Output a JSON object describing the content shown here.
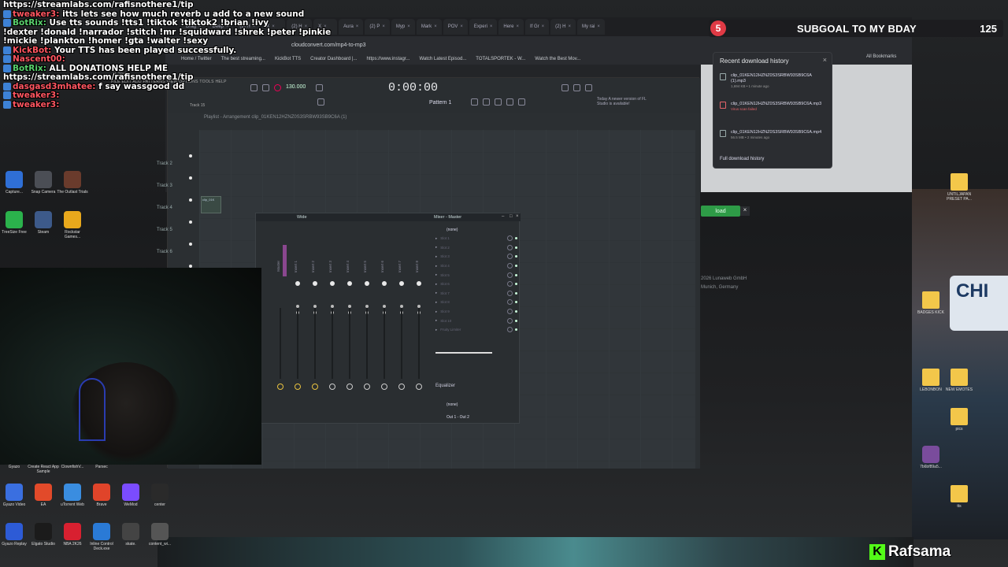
{
  "chat": {
    "lines": [
      {
        "text": "https://streamlabs.com/rafisnothere1/tip",
        "type": "plain"
      },
      {
        "user": "tweaker3:",
        "text": " itts lets see how much reverb u add to a new sound"
      },
      {
        "user": "BotRix:",
        "text": " Use tts sounds !tts1 !tiktok !tiktok2 !brian !ivy",
        "green": true
      },
      {
        "user": "",
        "text": "!dexter !donald !narrador !stitch !mr !squidward !shrek !peter !pinkie"
      },
      {
        "user": "",
        "text": "!mickie !plankton !homer !gta !walter !sexy"
      },
      {
        "user": "KickBot:",
        "text": " Your TTS has been played successfully."
      },
      {
        "user": "Nascent00:",
        "text": ""
      },
      {
        "user": "BotRix:",
        "text": " ALL DONATIONS HELP ME",
        "green": true
      },
      {
        "user": "",
        "text": "https://streamlabs.com/rafisnothere1/tip"
      },
      {
        "user": "dasgasd3mhatee:",
        "text": " f say wassgood dd"
      },
      {
        "user": "tweaker3:",
        "text": ""
      },
      {
        "user": "tweaker3:",
        "text": ""
      }
    ]
  },
  "subgoal": {
    "number": "5",
    "label": "SUBGOAL TO MY BDAY",
    "count": "125"
  },
  "browser": {
    "tabs": [
      "Drag",
      "Deep",
      "(2) H",
      "X",
      "(2) H",
      "X",
      "Aura",
      "(2) P",
      "Myp",
      "Mark",
      "POV",
      "Experi",
      "Here",
      "If Gr",
      "(2) H",
      "My rai"
    ],
    "url": "cloudconvert.com/mp4-to-mp3",
    "bookmarks": [
      "Home / Twitter",
      "The best streaming...",
      "KickBot TTS",
      "Creator Dashboard |...",
      "https://www.instagr...",
      "Watch Latest Episod...",
      "TOTALSPORTEK - W...",
      "Watch the Best Mov..."
    ],
    "all_bookmarks": "All Bookmarks",
    "page_button": "load",
    "page_footer_1": "2026 Lunaweb GmbH",
    "page_footer_2": "Munich, Germany"
  },
  "downloads": {
    "title": "Recent download history",
    "items": [
      {
        "name": "clip_01KEN12HZNZ0S3SRBW93SB9C6A (1).mp3",
        "status": "1,694 KB • 1 minute ago",
        "error": false
      },
      {
        "name": "clip_01KEN12HZNZ0S3SRBW93SB9C6A.mp3",
        "status": "Virus scan failed",
        "error": true
      },
      {
        "name": "clip_01KEN12HZNZ0S3SRBW93SB9C6A.mp4",
        "status": "56.5 MB • 2 minutes ago",
        "error": false
      }
    ],
    "full_history": "Full download history"
  },
  "fl": {
    "menu": "FILE EDIT ADD PATTERNS VIEW OPTIONS TOOLS HELP",
    "studio": "FL Studio",
    "track_label": "Track 15",
    "tempo": "130.000",
    "time": "0:00:00",
    "pattern": "Pattern 1",
    "news": "Today  A newer version of FL Studio is available!",
    "playlist_title": "Playlist - Arrangement  clip_01KEN12HZNZ0S3SRBW93SB9C6A (1)",
    "tracks": [
      "Track 1",
      "Track 2",
      "Track 3",
      "Track 4",
      "Track 5",
      "Track 6"
    ],
    "clip_label": "clip_01K"
  },
  "mixer": {
    "title": "Wide",
    "master_title": "Mixer - Master",
    "none": "(none)",
    "strips": [
      "Master",
      "Insert 1",
      "Insert 2",
      "Insert 3",
      "Insert 4",
      "Insert 5",
      "Insert 6",
      "Insert 7",
      "Insert 8"
    ],
    "slots": [
      "Slot 1",
      "Slot 2",
      "Slot 3",
      "Slot 4",
      "Slot 5",
      "Slot 6",
      "Slot 7",
      "Slot 8",
      "Slot 9",
      "Slot 10",
      "Fruity Limiter"
    ],
    "equalizer": "Equalizer",
    "none2": "(none)",
    "out": "Out 1 - Out 2"
  },
  "desktop_icons": {
    "left_row1": [
      "Capture...",
      "Snap Camera",
      "The Outlast Trials"
    ],
    "left_row2": [
      "TreeSize Free",
      "Steam",
      "Rockstar Games..."
    ],
    "bottom_row1": [
      "Gyazo",
      "Create React App Sample",
      "ClownfishV...",
      "Parsec"
    ],
    "bottom_row2": [
      "Gyazo Video",
      "EA",
      "uTorrent Web",
      "Brave",
      "WeMod",
      "center"
    ],
    "bottom_row3": [
      "Gyazo Replay",
      "Elgato Studio",
      "NBA 2K26",
      "Inline Control Deck.exe",
      "skate.",
      "content_wi..."
    ],
    "right": [
      "UNTILJAPAN PRESET PA...",
      "BADGES KICK",
      "LEBONBON",
      "NEW EMOTES",
      "pics",
      "7b6bf89a5...",
      "tts"
    ]
  },
  "stadium_sign": "CHI",
  "streamer": "Rafsama",
  "colors": {
    "kick_green": "#53fc18",
    "goal_red": "#e03a45",
    "chat_user": "#ff5560",
    "bot_green": "#58d06c"
  }
}
